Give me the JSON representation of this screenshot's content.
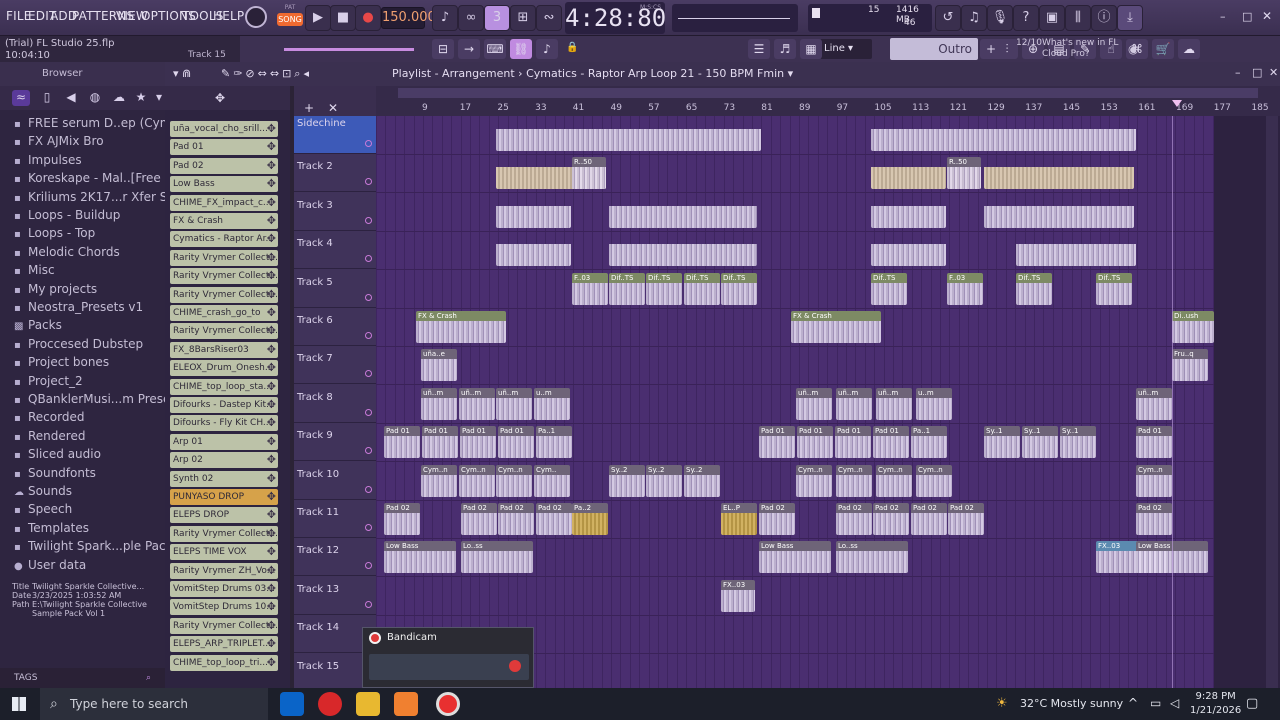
{
  "menu": [
    "FILE",
    "EDIT",
    "ADD",
    "PATTERNS",
    "VIEW",
    "OPTIONS",
    "TOOLS",
    "HELP"
  ],
  "transport": {
    "pat": "PAT",
    "song": "SONG",
    "bpm": "150.000",
    "clock": "4:28:80",
    "clock_unit": "M:S:CS",
    "cpu_label1": "15",
    "mem": "1416 MB",
    "mem2": "46"
  },
  "hint": {
    "title": "(Trial) FL Studio 25.flp",
    "time": "10:04:10",
    "track": "Track 15"
  },
  "toolbar2": {
    "snap": "Line",
    "pattern": "Outro"
  },
  "news": {
    "counter": "12/10",
    "text": "What's new in FL Cloud Pro?"
  },
  "browser": {
    "title": "Browser",
    "items": [
      {
        "icon": "folder",
        "label": "FREE serum D..ep (Cymatics)"
      },
      {
        "icon": "folder",
        "label": "FX AJMix Bro"
      },
      {
        "icon": "folder",
        "label": "Impulses"
      },
      {
        "icon": "folder",
        "label": "Koreskape - Mal..[Free Pack]"
      },
      {
        "icon": "folder",
        "label": "Kriliums 2K17...r Xfer Serum"
      },
      {
        "icon": "folder",
        "label": "Loops - Buildup"
      },
      {
        "icon": "folder",
        "label": "Loops - Top"
      },
      {
        "icon": "folder",
        "label": "Melodic Chords"
      },
      {
        "icon": "folder",
        "label": "Misc"
      },
      {
        "icon": "folder",
        "label": "My projects"
      },
      {
        "icon": "folder",
        "label": "Neostra_Presets v1"
      },
      {
        "icon": "packs",
        "label": "Packs"
      },
      {
        "icon": "folder",
        "label": "Proccesed Dubstep"
      },
      {
        "icon": "folder",
        "label": "Project bones"
      },
      {
        "icon": "folder",
        "label": "Project_2"
      },
      {
        "icon": "folder",
        "label": "QBanklerMusi...m Presets (1)"
      },
      {
        "icon": "folder",
        "label": "Recorded"
      },
      {
        "icon": "folder",
        "label": "Rendered"
      },
      {
        "icon": "folder",
        "label": "Sliced audio"
      },
      {
        "icon": "folder",
        "label": "Soundfonts"
      },
      {
        "icon": "cloud",
        "label": "Sounds"
      },
      {
        "icon": "folder",
        "label": "Speech"
      },
      {
        "icon": "folder",
        "label": "Templates"
      },
      {
        "icon": "folder",
        "label": "Twilight Spark...ple Pack Vol 1"
      },
      {
        "icon": "user",
        "label": "User data"
      }
    ],
    "footer": {
      "title_label": "Title",
      "title": "Twilight Sparkle Collective...",
      "date_label": "Date",
      "date": "3/23/2025 1:03:52 AM",
      "path_label": "Path",
      "path": "E:\\Twilight Sparkle Collective Sample Pack Vol 1"
    },
    "tags": "TAGS"
  },
  "channels": [
    {
      "label": "uña_vocal_cho_srill...",
      "color": "normal"
    },
    {
      "label": "Pad 01",
      "color": "normal"
    },
    {
      "label": "Pad 02",
      "color": "normal"
    },
    {
      "label": "Low Bass",
      "color": "normal"
    },
    {
      "label": "CHIME_FX_impact_c...",
      "color": "normal"
    },
    {
      "label": "FX & Crash",
      "color": "normal"
    },
    {
      "label": "Cymatics - Raptor Ar...",
      "color": "normal"
    },
    {
      "label": "Rarity Vrymer Collect...",
      "color": "normal"
    },
    {
      "label": "Rarity Vrymer Collect...",
      "color": "normal"
    },
    {
      "label": "Rarity Vrymer Collect...",
      "color": "normal"
    },
    {
      "label": "CHIME_crash_go_to",
      "color": "normal"
    },
    {
      "label": "Rarity Vrymer Collect...",
      "color": "normal"
    },
    {
      "label": "FX_8BarsRiser03",
      "color": "normal"
    },
    {
      "label": "ELEOX_Drum_Onesh...",
      "color": "normal"
    },
    {
      "label": "CHIME_top_loop_sta...",
      "color": "normal"
    },
    {
      "label": "Difourks - Dastep Kit...",
      "color": "normal"
    },
    {
      "label": "Difourks - Fly Kit CH...",
      "color": "normal"
    },
    {
      "label": "Arp 01",
      "color": "normal"
    },
    {
      "label": "Arp 02",
      "color": "normal"
    },
    {
      "label": "Synth 02",
      "color": "normal"
    },
    {
      "label": "PUNYASO DROP",
      "color": "orange"
    },
    {
      "label": "ELEPS DROP",
      "color": "normal"
    },
    {
      "label": "Rarity Vrymer Collect...",
      "color": "normal"
    },
    {
      "label": "ELEPS TIME VOX",
      "color": "normal"
    },
    {
      "label": "Rarity Vrymer ZH_Vo...",
      "color": "normal"
    },
    {
      "label": "VomitStep Drums 03...",
      "color": "normal"
    },
    {
      "label": "VomitStep Drums 10...",
      "color": "normal"
    },
    {
      "label": "Rarity Vrymer Collect...",
      "color": "normal"
    },
    {
      "label": "ELEPS_ARP_TRIPLET...",
      "color": "normal"
    },
    {
      "label": "CHIME_top_loop_tri...",
      "color": "normal"
    }
  ],
  "playlist": {
    "title": "Playlist - Arrangement",
    "pattern": "Cymatics - Raptor Arp Loop 21 - 150 BPM Fmin",
    "ruler": [
      "9",
      "17",
      "25",
      "33",
      "41",
      "49",
      "57",
      "65",
      "73",
      "81",
      "89",
      "97",
      "105",
      "113",
      "121",
      "129",
      "137",
      "145",
      "153",
      "161",
      "169",
      "177",
      "185"
    ],
    "tracks": [
      "Sidechine",
      "Track 2",
      "Track 3",
      "Track 4",
      "Track 5",
      "Track 6",
      "Track 7",
      "Track 8",
      "Track 9",
      "Track 10",
      "Track 11",
      "Track 12",
      "Track 13",
      "Track 14",
      "Track 15"
    ],
    "clips": {
      "r1": [
        "R..50",
        "R..50"
      ],
      "r4": [
        "F..03",
        "Dif..TS",
        "Dif..TS",
        "Dif..TS",
        "Dif..TS",
        "Dif..TS",
        "F..03",
        "Dif..TS",
        "Dif..TS"
      ],
      "r5": [
        "FX & Crash",
        "FX & Crash",
        "Di..ush"
      ],
      "r6": [
        "uña..e",
        "Fru..q"
      ],
      "r7": [
        "uñ..m",
        "uñ..m",
        "uñ..m",
        "u..m",
        "uñ..m",
        "uñ..m",
        "uñ..m",
        "u..m",
        "uñ..m"
      ],
      "r8": [
        "Pad 01",
        "Pad 01",
        "Pad 01",
        "Pad 01",
        "Pa..1",
        "Pad 01",
        "Pad 01",
        "Pad 01",
        "Pad 01",
        "Pa..1",
        "Sy..1",
        "Sy..1",
        "Sy..1",
        "Pad 01"
      ],
      "r9": [
        "Cym..n",
        "Cym..n",
        "Cym..n",
        "Cym..",
        "Sy..2",
        "Sy..2",
        "Sy..2",
        "Cym..n",
        "Cym..n",
        "Cym..n",
        "Cym..n",
        "Cym..n"
      ],
      "r10": [
        "Pad 02",
        "Pad 02",
        "Pad 02",
        "Pad 02",
        "Pa..2",
        "EL..P",
        "Pad 02",
        "Pad 02",
        "Pad 02",
        "Pad 02",
        "Pad 02",
        "Pad 02"
      ],
      "r11": [
        "Low Bass",
        "Lo..ss",
        "Low Bass",
        "Lo..ss",
        "FX..03",
        "Low Bass"
      ],
      "r12": [
        "FX..03"
      ]
    }
  },
  "bandicam": {
    "title": "Bandicam"
  },
  "taskbar": {
    "search": "Type here to search",
    "weather": "32°C  Mostly sunny",
    "time": "9:28 PM",
    "date": "1/21/2026"
  }
}
